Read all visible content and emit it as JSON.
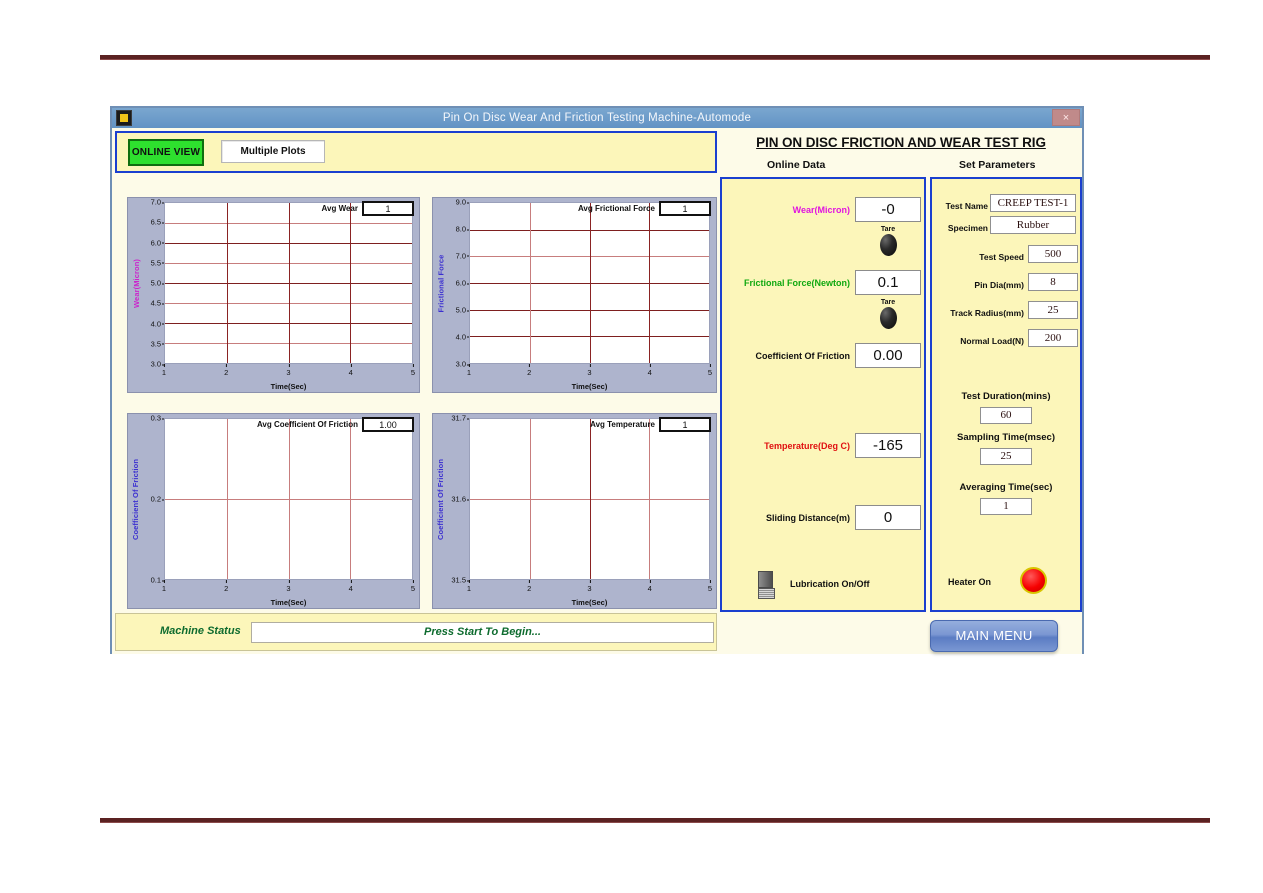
{
  "window": {
    "title": "Pin On Disc Wear And Friction Testing Machine-Automode",
    "close_label": "×",
    "app_icon": "labview-icon"
  },
  "toolbar": {
    "online_view_label": "ONLINE VIEW",
    "multiple_plots_label": "Multiple Plots"
  },
  "header": {
    "rig_title": "PIN ON DISC FRICTION AND WEAR TEST RIG",
    "online_data_heading": "Online Data",
    "set_parameters_heading": "Set Parameters"
  },
  "status": {
    "label": "Machine Status",
    "value": "Press Start To Begin..."
  },
  "footer": {
    "main_menu_label": "MAIN MENU"
  },
  "online_data": {
    "wear": {
      "label": "Wear(Micron)",
      "value": "-0",
      "tare_label": "Tare"
    },
    "frictional_force": {
      "label": "Frictional Force(Newton)",
      "value": "0.1",
      "tare_label": "Tare"
    },
    "coefficient_of_friction": {
      "label": "Coefficient Of Friction",
      "value": "0.00"
    },
    "temperature": {
      "label": "Temperature(Deg C)",
      "value": "-165"
    },
    "sliding_distance": {
      "label": "Sliding Distance(m)",
      "value": "0"
    },
    "lubrication": {
      "label": "Lubrication On/Off",
      "state": "off"
    }
  },
  "set_parameters": {
    "test_name": {
      "label": "Test Name",
      "value": "CREEP TEST-1"
    },
    "specimen": {
      "label": "Specimen",
      "value": "Rubber"
    },
    "test_speed": {
      "label": "Test Speed",
      "value": "500"
    },
    "pin_dia": {
      "label": "Pin Dia(mm)",
      "value": "8"
    },
    "track_radius": {
      "label": "Track Radius(mm)",
      "value": "25"
    },
    "normal_load": {
      "label": "Normal Load(N)",
      "value": "200"
    },
    "test_duration": {
      "label": "Test Duration(mins)",
      "value": "60"
    },
    "sampling_time": {
      "label": "Sampling Time(msec)",
      "value": "25"
    },
    "averaging_time": {
      "label": "Averaging Time(sec)",
      "value": "1"
    },
    "heater": {
      "label": "Heater On",
      "state": "on",
      "color": "#f60000"
    }
  },
  "colors": {
    "panel_bg": "#fcf6ba",
    "panel_border": "#1a3fcf",
    "plot_frame": "#aeb4cd",
    "gridline": "#7e1f1f",
    "green_button": "#2ee02e",
    "status_text": "#0d6b2e"
  },
  "chart_data": [
    {
      "type": "line",
      "id": "wear-chart",
      "title": "",
      "xlabel": "Time(Sec)",
      "ylabel": "Wear(Micron)",
      "ylabel_color": "#cc22cc",
      "xlim": [
        1,
        5
      ],
      "ylim": [
        3.0,
        7.0
      ],
      "xticks": [
        "1",
        "2",
        "3",
        "4",
        "5"
      ],
      "yticks": [
        "7.0",
        "6.5",
        "6.0",
        "5.5",
        "5.0",
        "4.5",
        "4.0",
        "3.5",
        "3.0"
      ],
      "grid": true,
      "legend": {
        "label": "Avg Wear",
        "value": "1",
        "position": "top-right"
      },
      "series": [
        {
          "name": "Avg Wear",
          "x": [],
          "y": []
        }
      ]
    },
    {
      "type": "line",
      "id": "frictional-force-chart",
      "title": "",
      "xlabel": "Time(Sec)",
      "ylabel": "Frictional Force",
      "ylabel_color": "#3b2fd0",
      "xlim": [
        1,
        5
      ],
      "ylim": [
        3.0,
        9.0
      ],
      "xticks": [
        "1",
        "2",
        "3",
        "4",
        "5"
      ],
      "yticks": [
        "9.0",
        "8.0",
        "7.0",
        "6.0",
        "5.0",
        "4.0",
        "3.0"
      ],
      "grid": true,
      "legend": {
        "label": "Avg Frictional Force",
        "value": "1",
        "position": "top-right"
      },
      "series": [
        {
          "name": "Avg Frictional Force",
          "x": [],
          "y": []
        }
      ]
    },
    {
      "type": "line",
      "id": "coefficient-of-friction-chart",
      "title": "",
      "xlabel": "Time(Sec)",
      "ylabel": "Coefficient Of Friction",
      "ylabel_color": "#3b2fd0",
      "xlim": [
        1,
        5
      ],
      "ylim": [
        0.1,
        0.3
      ],
      "xticks": [
        "1",
        "2",
        "3",
        "4",
        "5"
      ],
      "yticks": [
        "0.3",
        "0.2",
        "0.1"
      ],
      "grid": true,
      "legend": {
        "label": "Avg Coefficient Of Friction",
        "value": "1.00",
        "position": "top-right"
      },
      "series": [
        {
          "name": "Avg Coefficient Of Friction",
          "x": [],
          "y": []
        }
      ]
    },
    {
      "type": "line",
      "id": "temperature-chart",
      "title": "",
      "xlabel": "Time(Sec)",
      "ylabel": "Coefficient Of Friction",
      "ylabel_color": "#3b2fd0",
      "xlim": [
        1,
        5
      ],
      "ylim": [
        31.5,
        31.7
      ],
      "xticks": [
        "1",
        "2",
        "3",
        "4",
        "5"
      ],
      "yticks": [
        "31.7",
        "31.6",
        "31.5"
      ],
      "grid": true,
      "legend": {
        "label": "Avg Temperature",
        "value": "1",
        "position": "top-right"
      },
      "series": [
        {
          "name": "Avg Temperature",
          "x": [],
          "y": []
        }
      ]
    }
  ]
}
